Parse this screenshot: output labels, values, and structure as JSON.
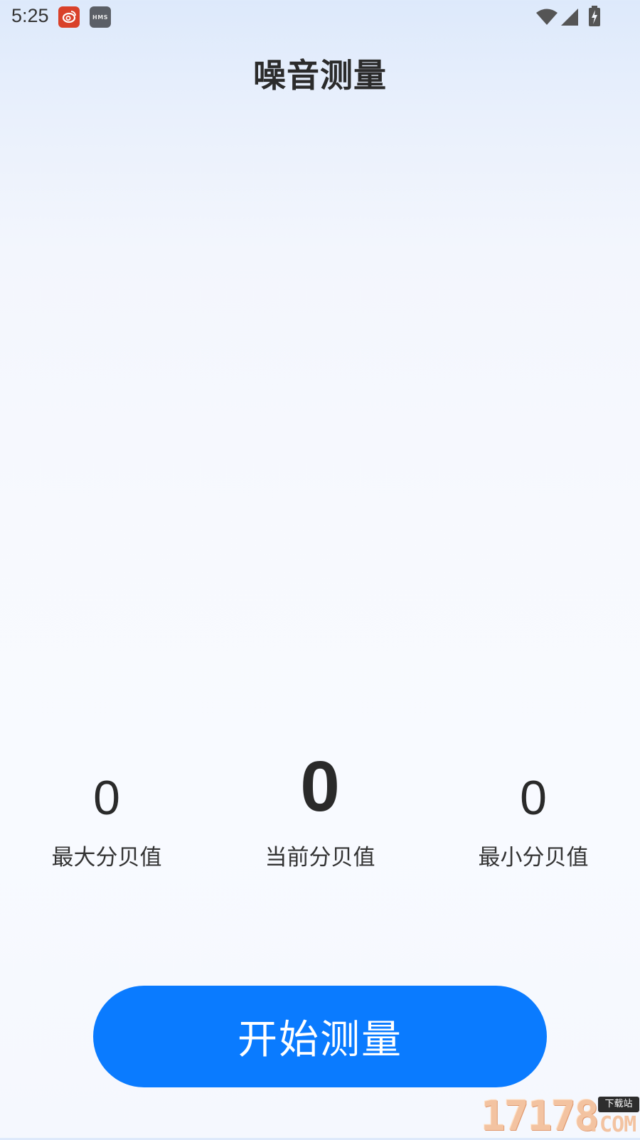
{
  "status_bar": {
    "time": "5:25",
    "hms_label": "HMS",
    "icons": [
      "weibo-icon",
      "hms-icon",
      "wifi-icon",
      "signal-icon",
      "battery-charging-icon"
    ]
  },
  "header": {
    "title": "噪音测量"
  },
  "stats": {
    "max": {
      "value": "0",
      "label": "最大分贝值"
    },
    "current": {
      "value": "0",
      "label": "当前分贝值"
    },
    "min": {
      "value": "0",
      "label": "最小分贝值"
    }
  },
  "actions": {
    "start_label": "开始测量"
  },
  "watermark": {
    "number": "17178",
    "download": "下载站",
    "domain": ".COM"
  },
  "colors": {
    "accent": "#0a7bff",
    "text": "#2a2a2a",
    "weibo_badge": "#d9412a",
    "hms_badge": "#5b5f66"
  }
}
